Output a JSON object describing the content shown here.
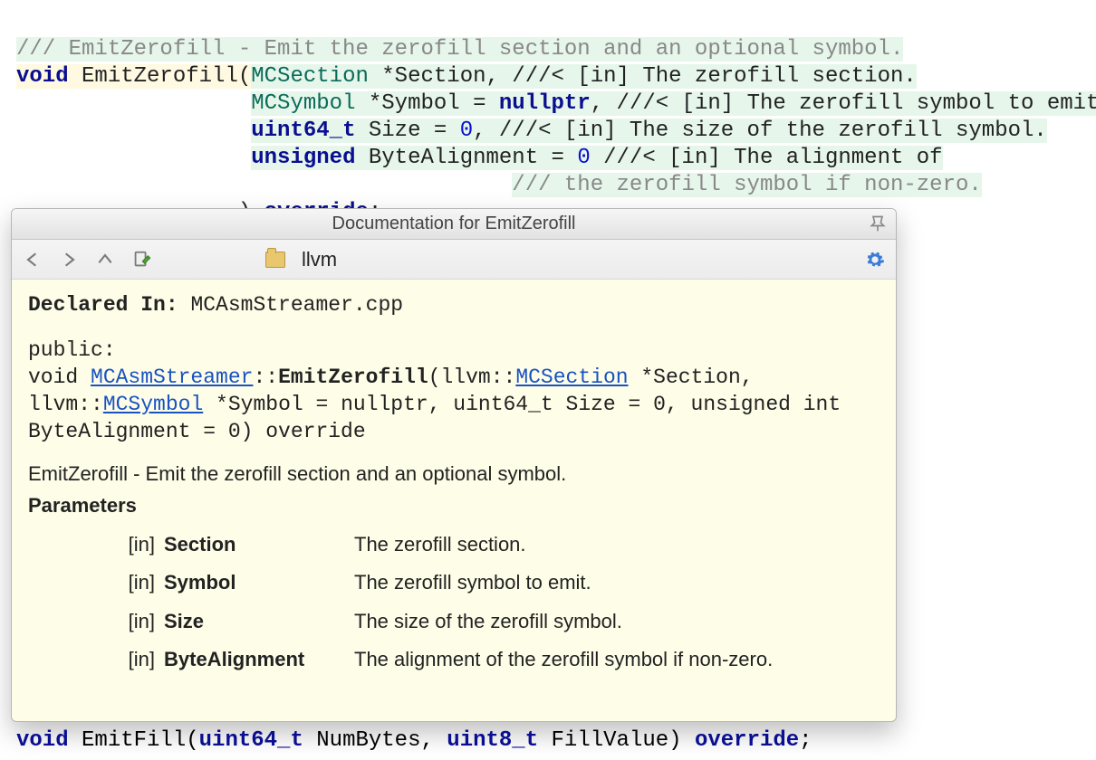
{
  "code": {
    "l1_cmt": "/// EmitZerofill - Emit the zerofill section and an optional symbol.",
    "l2_void": "void",
    "l2_fn": "EmitZerofill",
    "l2_type": "MCSection",
    "l2_rest": " *Section, ///< [in] The zerofill section.",
    "l3_pad": "                  ",
    "l3_type": "MCSymbol",
    "l3_mid": " *Symbol = ",
    "l3_null": "nullptr",
    "l3_rest": ", ///< [in] The zerofill symbol to emit.",
    "l4_pad": "                  ",
    "l4_type": "uint64_t",
    "l4_mid": " Size = ",
    "l4_num": "0",
    "l4_rest": ", ///< [in] The size of the zerofill symbol.",
    "l5_pad": "                  ",
    "l5_type": "unsigned",
    "l5_mid": " ByteAlignment = ",
    "l5_num": "0",
    "l5_rest": " ///< [in] The alignment of",
    "l6_pad": "                                      ",
    "l6_rest": "/// the zerofill symbol if non-zero.",
    "l7_pad": "                 ",
    "l7_close": ") ",
    "l7_override": "override",
    "l7_semi": ";"
  },
  "bottom": {
    "void": "void",
    "fn": " EmitFill(",
    "t1": "uint64_t",
    "a1": " NumBytes, ",
    "t2": "uint8_t",
    "a2": " FillValue) ",
    "ov": "override",
    "semi": ";"
  },
  "popup": {
    "title": "Documentation for EmitZerofill",
    "module": "llvm",
    "declared_label": "Declared In:",
    "declared_value": " MCAsmStreamer.cpp",
    "access": "public:",
    "sig_void": "void ",
    "sig_class": "MCAsmStreamer",
    "sig_sep": "::",
    "sig_fn": "EmitZerofill",
    "sig_open": "(llvm::",
    "sig_t1": "MCSection",
    "sig_p1": " *Section,",
    "sig_line2a": "llvm::",
    "sig_t2": "MCSymbol",
    "sig_line2b": " *Symbol = nullptr, uint64_t Size = 0, unsigned int",
    "sig_line3": "ByteAlignment = 0) override",
    "summary": "EmitZerofill - Emit the zerofill section and an optional symbol.",
    "params_heading": "Parameters",
    "params": [
      {
        "dir": "[in]",
        "name": "Section",
        "desc": "The zerofill section."
      },
      {
        "dir": "[in]",
        "name": "Symbol",
        "desc": "The zerofill symbol to emit."
      },
      {
        "dir": "[in]",
        "name": "Size",
        "desc": "The size of the zerofill symbol."
      },
      {
        "dir": "[in]",
        "name": "ByteAlignment",
        "desc": "The alignment of the zerofill symbol if non-zero."
      }
    ]
  }
}
